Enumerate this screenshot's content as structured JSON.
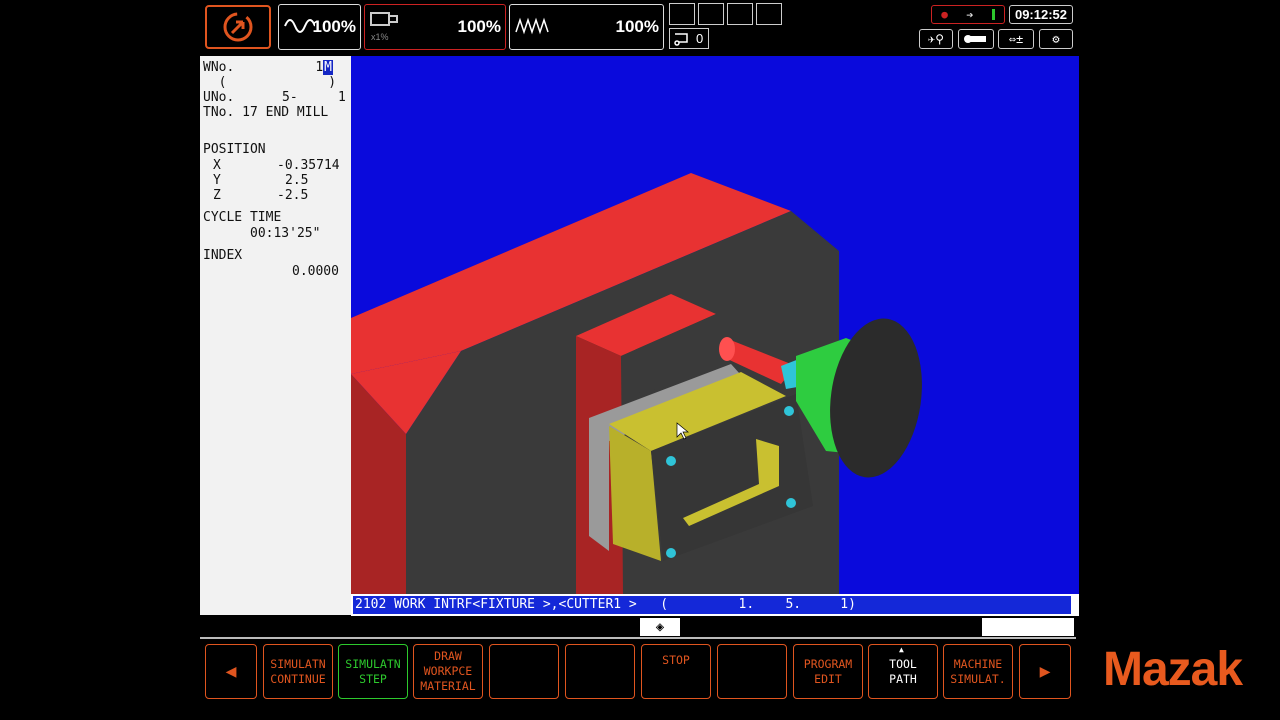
{
  "topbar": {
    "overrides": [
      {
        "value": "100%",
        "icon": "sine-wave-icon"
      },
      {
        "value": "100%",
        "icon": "spindle-icon",
        "sub": "x1%"
      },
      {
        "value": "100%",
        "icon": "zigzag-wave-icon"
      }
    ],
    "counter_value": "0",
    "clock": "09:12:52"
  },
  "info": {
    "wno_label": "WNo.",
    "wno_value": "1",
    "wno_highlight": "M",
    "paren_line": "  (             )",
    "uno_label": "UNo.",
    "uno_value": "5-",
    "uno_value2": "1",
    "tno_line": "TNo. 17 END MILL",
    "position_label": "POSITION",
    "x_label": "X",
    "x_value": "-0.35714",
    "y_label": "Y",
    "y_value": "2.5",
    "z_label": "Z",
    "z_value": "-2.5",
    "cycle_label": "CYCLE TIME",
    "cycle_value": "00:13'25\"",
    "index_label": "INDEX",
    "index_value": "0.0000"
  },
  "message": "2102 WORK INTRF<FIXTURE >,<CUTTER1 >   (         1.    5.     1)",
  "fkeys": [
    {
      "label": "SIMULATN\nCONTINUE",
      "state": "normal"
    },
    {
      "label": "SIMULATN\nSTEP",
      "state": "active"
    },
    {
      "label": "DRAW\nWORKPCE\nMATERIAL",
      "state": "normal"
    },
    {
      "label": "",
      "state": "normal"
    },
    {
      "label": "",
      "state": "normal"
    },
    {
      "label": "STOP",
      "state": "normal"
    },
    {
      "label": "",
      "state": "normal"
    },
    {
      "label": "PROGRAM\nEDIT",
      "state": "normal"
    },
    {
      "label": "TOOL\nPATH",
      "state": "white"
    },
    {
      "label": "MACHINE\nSIMULAT.",
      "state": "normal"
    }
  ],
  "logo": "Mazak",
  "colors": {
    "accent": "#e0551f",
    "active": "#2dc92d",
    "viewport_bg": "#0a0adc",
    "message_bg": "#1428d8",
    "fixture_red": "#e83232",
    "body_dark": "#3a3a3a",
    "workpiece_yellow": "#c9c030",
    "tool_green": "#2ecc40"
  }
}
